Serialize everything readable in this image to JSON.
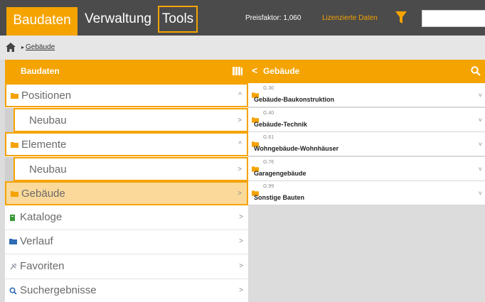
{
  "topbar": {
    "tabs": [
      {
        "label": "Baudaten"
      },
      {
        "label": "Verwaltung"
      },
      {
        "label": "Tools"
      }
    ],
    "price_label": "Preisfaktor: 1,060",
    "licensed_label": "Lizenzierte Daten",
    "search": {
      "value": "",
      "placeholder": ""
    }
  },
  "breadcrumb": {
    "separator": "▸",
    "item": "Gebäude"
  },
  "left_panel": {
    "title": "Baudaten",
    "items": [
      {
        "label": "Positionen",
        "chevron": "^",
        "icon": "folder-icon",
        "icon_color": "#f5a300"
      },
      {
        "label": "Neubau",
        "chevron": ">",
        "icon": "",
        "icon_color": ""
      },
      {
        "label": "Elemente",
        "chevron": "^",
        "icon": "folder-icon",
        "icon_color": "#f5a300"
      },
      {
        "label": "Neubau",
        "chevron": ">",
        "icon": "",
        "icon_color": ""
      },
      {
        "label": "Gebäude",
        "chevron": ">",
        "icon": "folder-icon",
        "icon_color": "#f5a300"
      },
      {
        "label": "Kataloge",
        "chevron": ">",
        "icon": "book-icon",
        "icon_color": "#3a9a3a"
      },
      {
        "label": "Verlauf",
        "chevron": ">",
        "icon": "folder-icon",
        "icon_color": "#2f6db5"
      },
      {
        "label": "Favoriten",
        "chevron": ">",
        "icon": "pin-icon",
        "icon_color": "#9aa0a8"
      },
      {
        "label": "Suchergebnisse",
        "chevron": ">",
        "icon": "search-icon",
        "icon_color": "#2f6db5"
      }
    ]
  },
  "right_panel": {
    "title": "Gebäude",
    "back": "<",
    "rows": [
      {
        "code": "G.30",
        "name": "Gebäude-Baukonstruktion",
        "chevron": "˅"
      },
      {
        "code": "G.40",
        "name": "Gebäude-Technik",
        "chevron": "˅"
      },
      {
        "code": "G.61",
        "name": "Wohngebäude-Wohnhäuser",
        "chevron": "˅"
      },
      {
        "code": "G.76",
        "name": "Garagengebäude",
        "chevron": "˅"
      },
      {
        "code": "G.99",
        "name": "Sonstige Bauten",
        "chevron": "˅"
      }
    ]
  },
  "colors": {
    "accent": "#f5a300",
    "topbar_bg": "#4b4b4b",
    "active_row": "#fbd99a"
  }
}
